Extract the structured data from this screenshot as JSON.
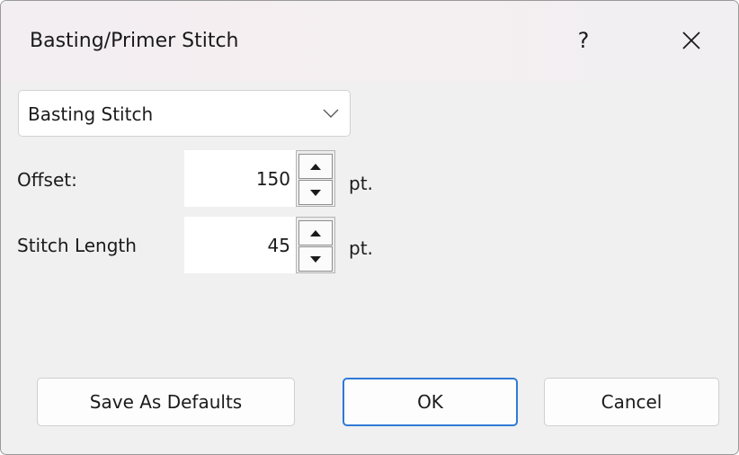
{
  "window": {
    "title": "Basting/Primer Stitch",
    "help_label": "?",
    "close_icon": "close-icon"
  },
  "stitch_type": {
    "selected": "Basting Stitch",
    "arrow_icon": "chevron-down-icon"
  },
  "offset": {
    "label": "Offset:",
    "value": "150",
    "unit": "pt."
  },
  "stitch_length": {
    "label": "Stitch Length",
    "value": "45",
    "unit": "pt."
  },
  "buttons": {
    "save_defaults": "Save As Defaults",
    "ok": "OK",
    "cancel": "Cancel"
  },
  "colors": {
    "accent": "#2e7ad6",
    "background": "#f0f0f0"
  }
}
